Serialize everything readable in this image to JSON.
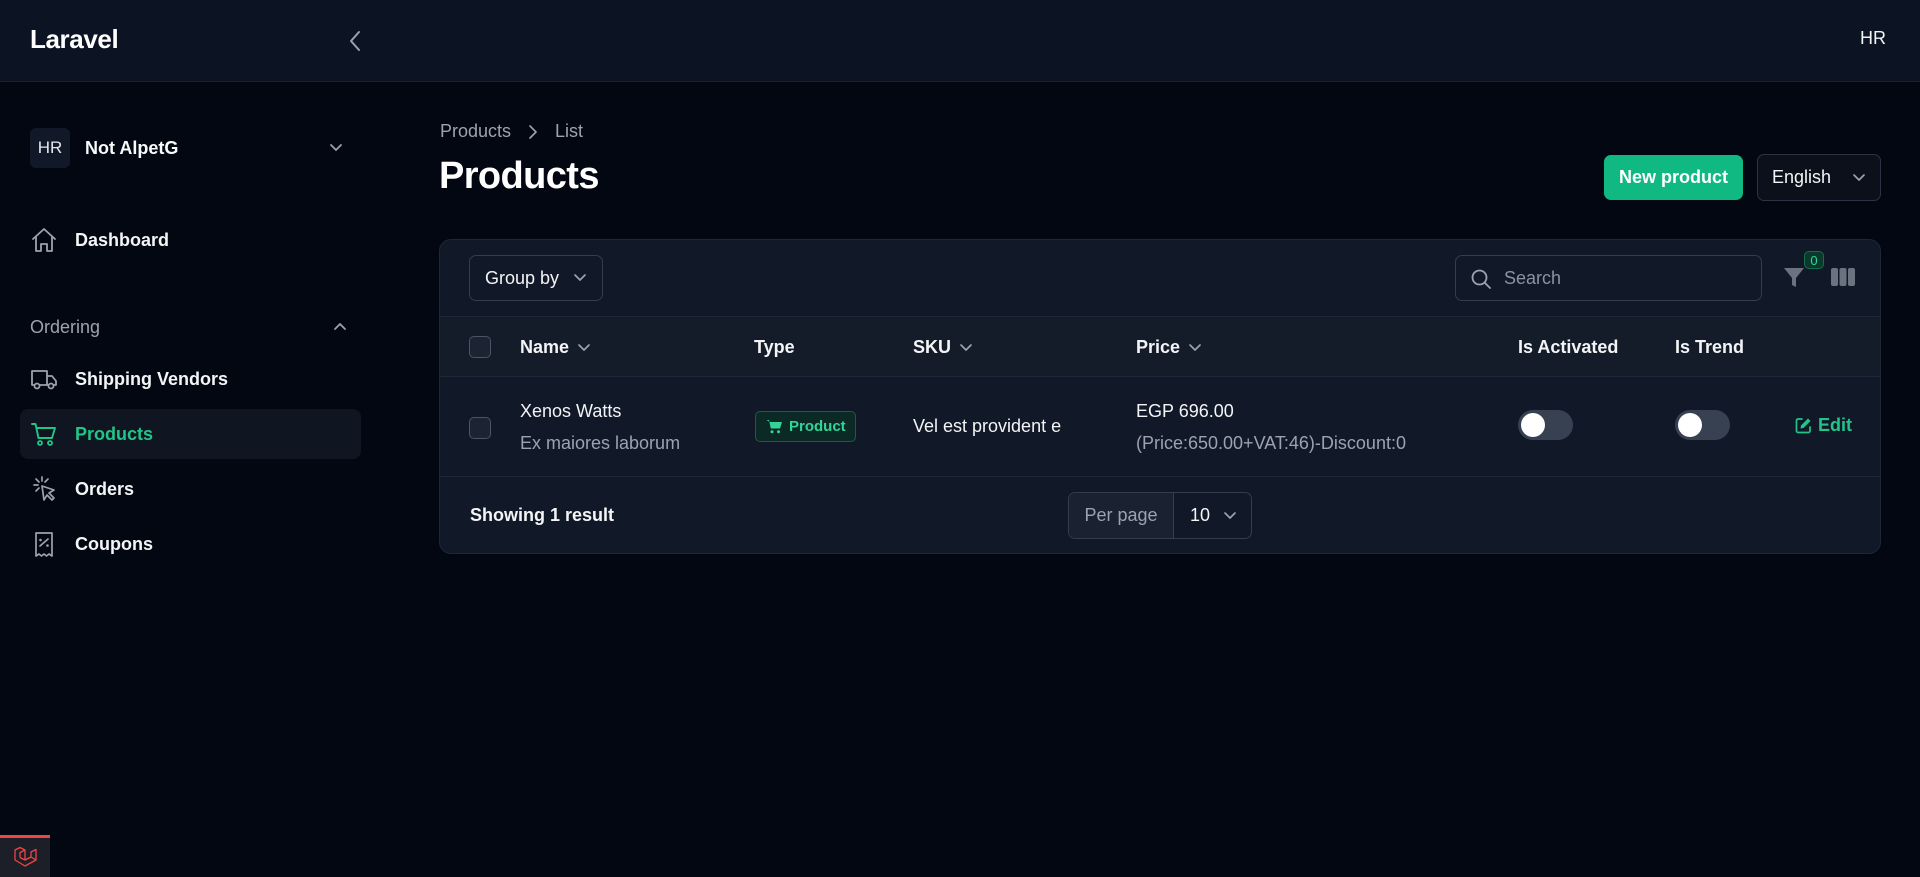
{
  "app": {
    "brand": "Laravel",
    "user_initials": "HR"
  },
  "sidebar": {
    "tenant": {
      "initials": "HR",
      "name": "Not AlpetG"
    },
    "items": [
      {
        "label": "Dashboard",
        "icon": "home-icon"
      }
    ],
    "group": {
      "label": "Ordering",
      "items": [
        {
          "label": "Shipping Vendors",
          "icon": "truck-icon"
        },
        {
          "label": "Products",
          "icon": "shopping-cart-icon",
          "active": true
        },
        {
          "label": "Orders",
          "icon": "cursor-click-icon"
        },
        {
          "label": "Coupons",
          "icon": "receipt-percent-icon"
        }
      ]
    }
  },
  "main": {
    "breadcrumb": [
      "Products",
      "List"
    ],
    "title": "Products",
    "new_button": "New product",
    "language": "English"
  },
  "table": {
    "group_by": "Group by",
    "search_placeholder": "Search",
    "filter_count": "0",
    "columns": {
      "name": "Name",
      "type": "Type",
      "sku": "SKU",
      "price": "Price",
      "is_activated": "Is Activated",
      "is_trend": "Is Trend"
    },
    "rows": [
      {
        "name": "Xenos Watts",
        "description": "Ex maiores laborum",
        "type": "Product",
        "sku": "Vel est provident e",
        "price": "EGP 696.00",
        "price_detail": "(Price:650.00+VAT:46)-Discount:0",
        "is_activated": false,
        "is_trend": false,
        "action": "Edit"
      }
    ],
    "footer": {
      "showing": "Showing 1 result",
      "per_page_label": "Per page",
      "per_page_value": "10"
    }
  },
  "colors": {
    "accent": "#10b981",
    "accent_text": "#22c587",
    "background": "#030712",
    "panel": "#111827",
    "dev_badge": "#ef4444"
  }
}
